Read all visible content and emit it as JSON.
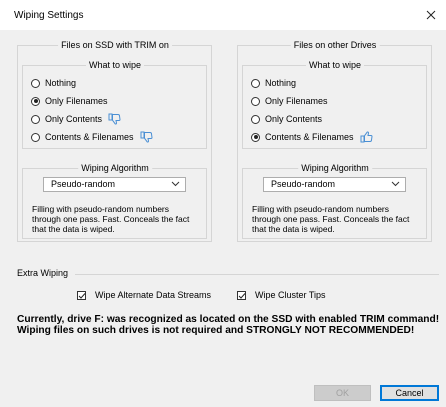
{
  "window": {
    "title": "Wiping Settings"
  },
  "ssd_panel": {
    "title": "Files on SSD with TRIM on",
    "what_to_wipe_label": "What to wipe",
    "options": [
      {
        "label": "Nothing",
        "checked": false
      },
      {
        "label": "Only Filenames",
        "checked": true
      },
      {
        "label": "Only Contents",
        "checked": false,
        "icon": "thumbs-down-icon"
      },
      {
        "label": "Contents & Filenames",
        "checked": false,
        "icon": "thumbs-down-icon"
      }
    ],
    "algorithm_label": "Wiping Algorithm",
    "algorithm_value": "Pseudo-random",
    "algorithm_desc": "Filling with pseudo-random numbers through one pass. Fast. Conceals the fact that the data is wiped."
  },
  "other_panel": {
    "title": "Files on other Drives",
    "what_to_wipe_label": "What to wipe",
    "options": [
      {
        "label": "Nothing",
        "checked": false
      },
      {
        "label": "Only Filenames",
        "checked": false
      },
      {
        "label": "Only Contents",
        "checked": false
      },
      {
        "label": "Contents & Filenames",
        "checked": true,
        "icon": "thumbs-up-icon"
      }
    ],
    "algorithm_label": "Wiping Algorithm",
    "algorithm_value": "Pseudo-random",
    "algorithm_desc": "Filling with pseudo-random numbers through one pass. Fast. Conceals the fact that the data is wiped."
  },
  "extra": {
    "label": "Extra Wiping",
    "ads_label": "Wipe Alternate Data Streams",
    "ads_checked": true,
    "cluster_label": "Wipe Cluster Tips",
    "cluster_checked": true
  },
  "warning": {
    "line1": "Currently, drive F: was recognized as located on the SSD with enabled TRIM command!",
    "line2": "Wiping files on such drives is not required and STRONGLY NOT RECOMMENDED!"
  },
  "buttons": {
    "ok": "OK",
    "cancel": "Cancel"
  },
  "colors": {
    "thumb_down": "#4a8fd4",
    "thumb_up": "#4a8fd4",
    "ok_disabled_text": "#a0a0a0",
    "cancel_border": "#0078d7"
  }
}
